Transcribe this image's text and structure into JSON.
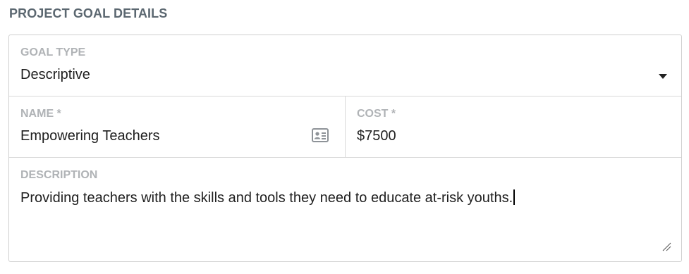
{
  "section": {
    "title": "PROJECT GOAL DETAILS"
  },
  "goal_type": {
    "label": "GOAL TYPE",
    "selected": "Descriptive"
  },
  "name": {
    "label": "NAME *",
    "value": "Empowering Teachers",
    "icon": "contact-card-icon"
  },
  "cost": {
    "label": "COST *",
    "value": "$7500"
  },
  "description": {
    "label": "DESCRIPTION",
    "value": "Providing teachers with the skills and tools they need to educate at-risk youths."
  },
  "colors": {
    "title": "#5b6770",
    "label": "#b0b3b6",
    "border": "#cfcfcf",
    "text": "#1f1f1f"
  }
}
